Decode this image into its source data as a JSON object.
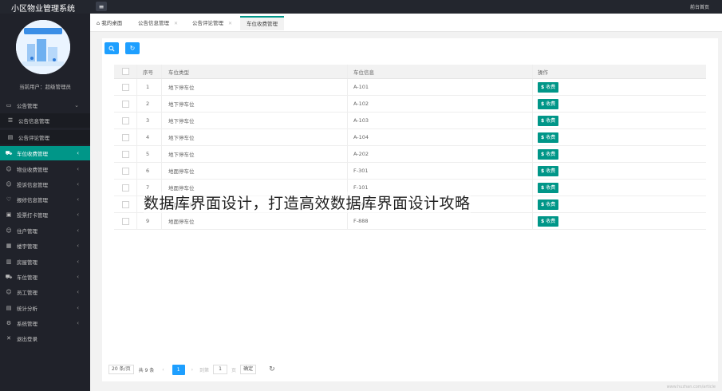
{
  "header": {
    "app_title": "小区物业管理系统",
    "right_link": "前台首页",
    "menu_icon": "hamburger-icon"
  },
  "sidebar": {
    "current_user_label": "当前用户：超级管理员",
    "items": [
      {
        "label": "公告管理",
        "icon": "announcement-icon",
        "arrow": "⌄",
        "sub": false,
        "active": false
      },
      {
        "label": "公告信息管理",
        "icon": "list-icon",
        "arrow": "",
        "sub": true,
        "active": false
      },
      {
        "label": "公告评论管理",
        "icon": "comment-icon",
        "arrow": "",
        "sub": true,
        "active": false
      },
      {
        "label": "车位收费管理",
        "icon": "car-icon",
        "arrow": "‹",
        "sub": false,
        "active": true
      },
      {
        "label": "物业收费管理",
        "icon": "user-icon",
        "arrow": "‹",
        "sub": false,
        "active": false
      },
      {
        "label": "投诉信息管理",
        "icon": "user-icon",
        "arrow": "‹",
        "sub": false,
        "active": false
      },
      {
        "label": "报修信息管理",
        "icon": "heart-icon",
        "arrow": "‹",
        "sub": false,
        "active": false
      },
      {
        "label": "投票打卡管理",
        "icon": "image-icon",
        "arrow": "‹",
        "sub": false,
        "active": false
      },
      {
        "label": "住户管理",
        "icon": "user-icon",
        "arrow": "‹",
        "sub": false,
        "active": false
      },
      {
        "label": "楼宇管理",
        "icon": "building-icon",
        "arrow": "‹",
        "sub": false,
        "active": false
      },
      {
        "label": "房屋管理",
        "icon": "grid-icon",
        "arrow": "‹",
        "sub": false,
        "active": false
      },
      {
        "label": "车位管理",
        "icon": "car-icon",
        "arrow": "‹",
        "sub": false,
        "active": false
      },
      {
        "label": "员工管理",
        "icon": "user-icon",
        "arrow": "‹",
        "sub": false,
        "active": false
      },
      {
        "label": "统计分析",
        "icon": "chart-icon",
        "arrow": "‹",
        "sub": false,
        "active": false
      },
      {
        "label": "系统管理",
        "icon": "gear-icon",
        "arrow": "‹",
        "sub": false,
        "active": false
      },
      {
        "label": "退出登录",
        "icon": "close-icon",
        "arrow": "",
        "sub": false,
        "active": false
      }
    ]
  },
  "tabs": [
    {
      "label": "我的桌面",
      "icon": "home-icon",
      "closable": false,
      "active": false
    },
    {
      "label": "公告信息管理",
      "closable": true,
      "active": false
    },
    {
      "label": "公告评论管理",
      "closable": true,
      "active": false
    },
    {
      "label": "车位收费管理",
      "closable": false,
      "active": true
    }
  ],
  "toolbar": {
    "search_icon": "search-icon",
    "refresh_icon": "refresh-icon"
  },
  "table": {
    "columns": [
      "序号",
      "车位类型",
      "车位信息",
      "操作"
    ],
    "pay_label": "收费",
    "rows": [
      {
        "no": "1",
        "type": "地下停车位",
        "info": "A-101"
      },
      {
        "no": "2",
        "type": "地下停车位",
        "info": "A-102"
      },
      {
        "no": "3",
        "type": "地下停车位",
        "info": "A-103"
      },
      {
        "no": "4",
        "type": "地下停车位",
        "info": "A-104"
      },
      {
        "no": "5",
        "type": "地下停车位",
        "info": "A-202"
      },
      {
        "no": "6",
        "type": "地面停车位",
        "info": "F-301"
      },
      {
        "no": "7",
        "type": "地面停车位",
        "info": "F-101"
      },
      {
        "no": "8",
        "type": "地面停车位",
        "info": "F-666"
      },
      {
        "no": "9",
        "type": "地面停车位",
        "info": "F-888"
      }
    ]
  },
  "pager": {
    "page_size": "20 条/页",
    "total": "共 9 条",
    "prev": "‹",
    "current_page": "1",
    "next": "›",
    "goto_label": "到第",
    "goto_value": "1",
    "page_unit": "页",
    "confirm": "确定"
  },
  "overlay_caption": "数据库界面设计，打造高效数据库界面设计攻略",
  "corner_watermark": "www.huzhan.com/article"
}
